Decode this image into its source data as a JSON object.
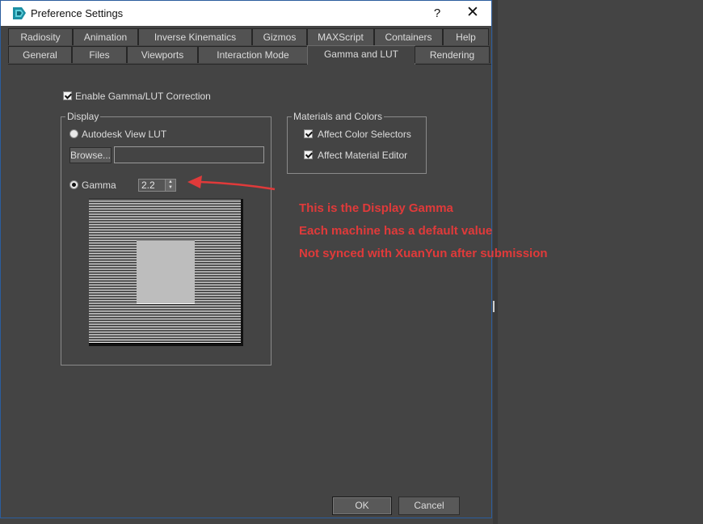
{
  "window": {
    "title": "Preference Settings",
    "help_glyph": "?",
    "close_glyph": "✕"
  },
  "tabs_row1": [
    "Radiosity",
    "Animation",
    "Inverse Kinematics",
    "Gizmos",
    "MAXScript",
    "Containers",
    "Help"
  ],
  "tabs_row2": [
    "General",
    "Files",
    "Viewports",
    "Interaction Mode",
    "Gamma and LUT",
    "Rendering"
  ],
  "active_tab": "Gamma and LUT",
  "gamma_lut": {
    "enable_label": "Enable Gamma/LUT Correction",
    "enable_checked": true,
    "display": {
      "title": "Display",
      "lut_label": "Autodesk View LUT",
      "lut_selected": false,
      "browse_label": "Browse...",
      "lut_path": "",
      "gamma_label": "Gamma",
      "gamma_selected": true,
      "gamma_value": "2.2"
    },
    "materials": {
      "title": "Materials and Colors",
      "affect_color_selectors_label": "Affect Color Selectors",
      "affect_color_selectors_checked": true,
      "affect_material_editor_label": "Affect Material Editor",
      "affect_material_editor_checked": true
    }
  },
  "annotation": {
    "lines": [
      "This is the Display Gamma",
      "Each machine has a default value",
      "Not synced with XuanYun after submission"
    ],
    "color": "#e03a3a"
  },
  "footer": {
    "ok_label": "OK",
    "cancel_label": "Cancel"
  },
  "icons": {
    "app": "3ds-max-logo-icon",
    "help": "question-mark-icon",
    "close": "close-icon",
    "arrow": "red-annotation-arrow"
  }
}
